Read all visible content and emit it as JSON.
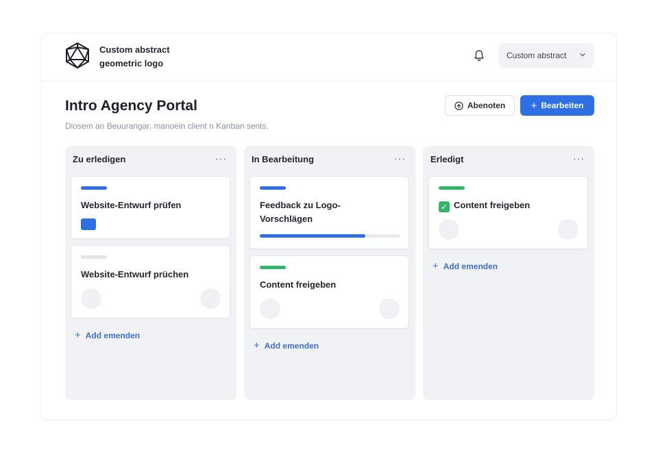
{
  "header": {
    "brand_line1": "Custom abstract",
    "brand_line2": "geometric logo",
    "account_label": "Custom abstract"
  },
  "page": {
    "title": "Intro Agency Portal",
    "subtitle": "Diosem an Beuurangar, manoein client n Kanban sents.",
    "secondary_button": "Abenoten",
    "primary_button": "Bearbeiten"
  },
  "colors": {
    "accent_blue": "#2f6fe4",
    "green": "#35b56a",
    "gray_tag": "#e3e5e9"
  },
  "columns": [
    {
      "title": "Zu erledigen",
      "more": "···",
      "add_label": "Add emenden",
      "cards": [
        {
          "title": "Website-Entwurf prüfen",
          "tag_color": "#2f6fe4"
        },
        {
          "title": "Website-Entwurf prüchen",
          "tag_color": "#e3e5e9"
        }
      ]
    },
    {
      "title": "In Bearbeitung",
      "more": "···",
      "add_label": "Add emenden",
      "cards": [
        {
          "title": "Feedback zu Logo-Vorschlägen",
          "tag_color": "#2f6fe4",
          "progress": 0.75
        },
        {
          "title": "Content freigeben",
          "tag_color": "#35b56a"
        }
      ]
    },
    {
      "title": "Erledigt",
      "more": "···",
      "add_label": "Add emenden",
      "cards": [
        {
          "title": "Content freigeben",
          "tag_color": "#35b56a",
          "check_icon": "check-mark-icon"
        }
      ]
    }
  ]
}
